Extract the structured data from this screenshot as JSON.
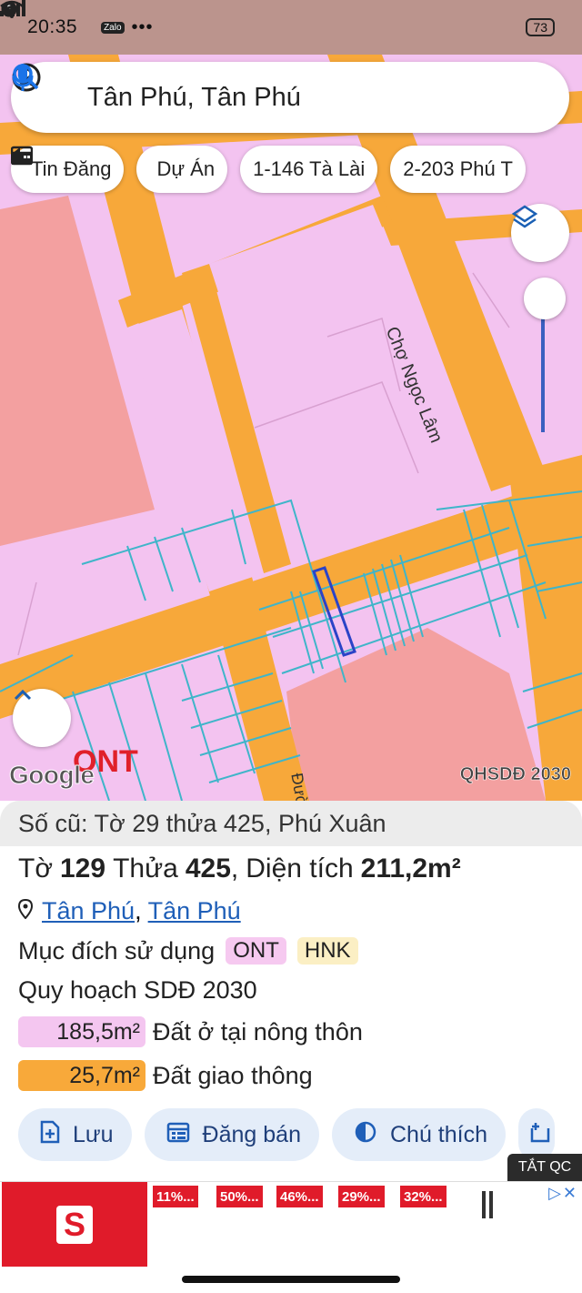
{
  "status_bar": {
    "time": "20:35",
    "battery": "73",
    "left_icons": [
      "messenger-icon",
      "facebook-icon",
      "zalo-icon",
      "more-dots-icon"
    ],
    "zalo_label": "Zalo",
    "right_icons": [
      "signal-icon",
      "signal-icon",
      "wifi-icon",
      "battery-icon"
    ]
  },
  "search": {
    "value": "Tân Phú, Tân Phú"
  },
  "chips": [
    {
      "label": "Tin Đăng",
      "icon": "listing-icon"
    },
    {
      "label": "Dự Án",
      "icon": "building-icon"
    },
    {
      "label": "1-146 Tà Lài",
      "icon": ""
    },
    {
      "label": "2-203 Phú T",
      "icon": ""
    }
  ],
  "map": {
    "road_label": "Chợ Ngọc Lâm",
    "road_label_2": "Đườ",
    "zone_label": "ONT",
    "logo": "Google",
    "layer_label": "QHSDĐ 2030",
    "colors": {
      "residential": "#f3c3f0",
      "road": "#f7a83a",
      "agricultural": "#f3a0a0",
      "parcel_lines": "#3fb5c9",
      "selected_parcel": "#2b43c7"
    }
  },
  "panel": {
    "old_info": "Số cũ: Tờ 29 thửa 425, Phú Xuân",
    "sheet_label": "Tờ",
    "sheet_no": "129",
    "parcel_label": "Thửa",
    "parcel_no": "425",
    "area_label": "Diện tích",
    "area_value": "211,2m²",
    "location_1": "Tân Phú",
    "location_sep": ",",
    "location_2": "Tân Phú",
    "purpose_label": "Mục đích sử dụng",
    "purpose_tags": [
      "ONT",
      "HNK"
    ],
    "plan_label": "Quy hoạch SDĐ 2030",
    "areas": [
      {
        "value": "185,5m²",
        "label": "Đất ở tại nông thôn",
        "color": "#f4c6f0"
      },
      {
        "value": "25,7m²",
        "label": "Đất giao thông",
        "color": "#f8a93a"
      }
    ],
    "actions": [
      {
        "label": "Lưu",
        "icon": "add-note-icon"
      },
      {
        "label": "Đăng bán",
        "icon": "calendar-icon"
      },
      {
        "label": "Chú thích",
        "icon": "contrast-icon"
      }
    ]
  },
  "ad": {
    "tag": "TẮT QC",
    "deals": [
      "11%...",
      "50%...",
      "46%...",
      "29%...",
      "32%..."
    ]
  }
}
